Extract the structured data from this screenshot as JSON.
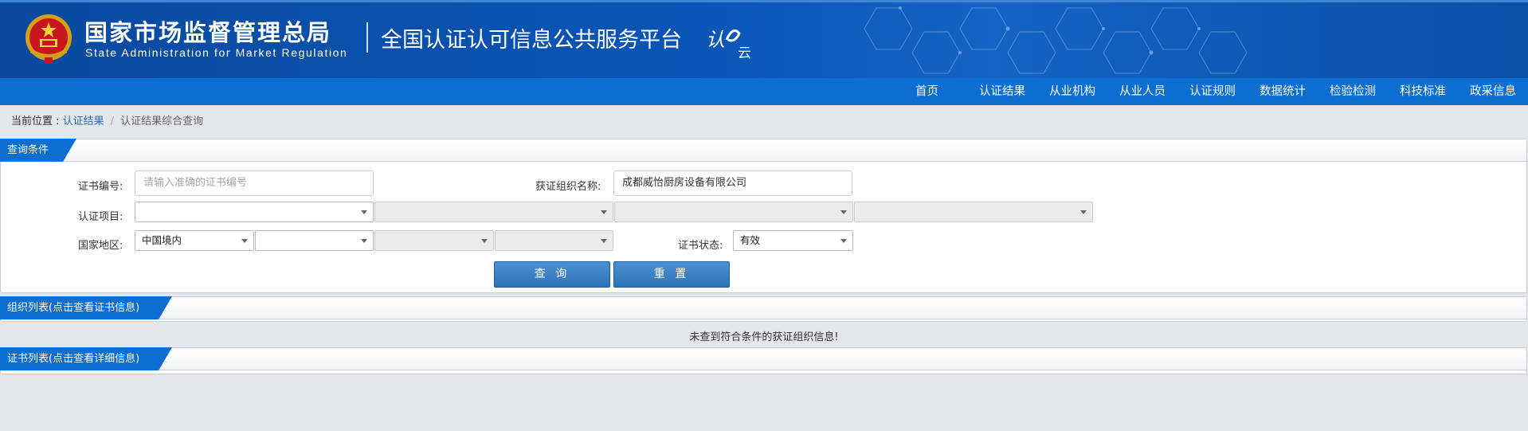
{
  "header": {
    "site_name_cn": "国家市场监督管理总局",
    "site_name_en": "State Administration  for  Market Regulation",
    "platform_title": "全国认证认可信息公共服务平台",
    "logo_text_1": "认",
    "logo_text_2": "云"
  },
  "nav": {
    "items": [
      "首页",
      "认证结果",
      "从业机构",
      "从业人员",
      "认证规则",
      "数据统计",
      "检验检测",
      "科技标准",
      "政采信息"
    ]
  },
  "breadcrumb": {
    "prefix": "当前位置 : ",
    "link": "认证结果",
    "separator": "/",
    "current": "认证结果综合查询"
  },
  "query": {
    "section_title": "查询条件",
    "cert_no": {
      "label": "证书编号:",
      "placeholder": "请输入准确的证书编号",
      "value": ""
    },
    "org_name": {
      "label": "获证组织名称:",
      "value": "成都威怡厨房设备有限公司"
    },
    "cert_project": {
      "label": "认证项目:",
      "values": [
        "",
        "",
        "",
        ""
      ]
    },
    "region": {
      "label": "国家地区:",
      "values": [
        "中国境内",
        "",
        "",
        ""
      ]
    },
    "cert_status": {
      "label": "证书状态:",
      "value": "有效"
    },
    "search_button": "查 询",
    "reset_button": "重 置"
  },
  "org_list": {
    "section_title": "组织列表(点击查看证书信息)",
    "empty_message": "未查到符合条件的获证组织信息!"
  },
  "cert_list": {
    "section_title": "证书列表(点击查看详细信息)"
  },
  "colors": {
    "header_blue": "#0a55b5",
    "nav_blue": "#0a6fd0",
    "button_blue": "#2f74b8",
    "page_bg": "#e3e7ec"
  }
}
